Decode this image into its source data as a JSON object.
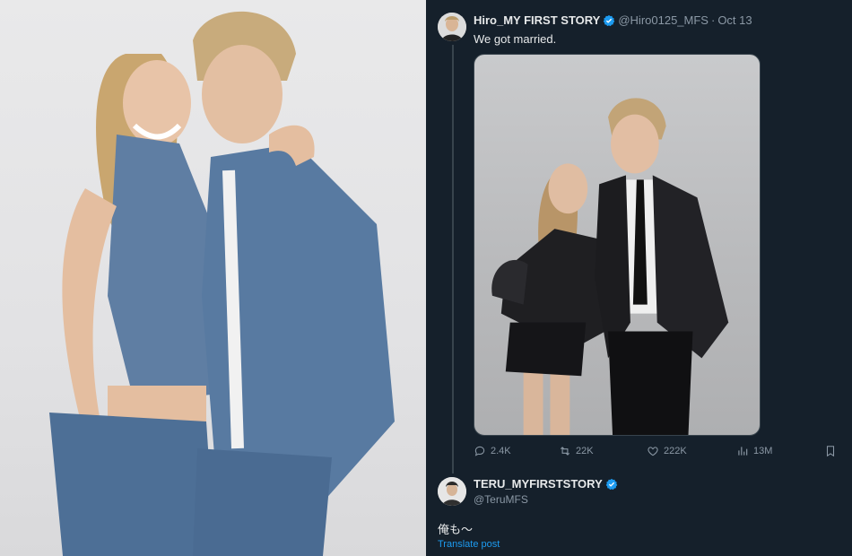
{
  "left_photo": {
    "icon": "couple-denim-photo"
  },
  "post": {
    "display_name": "Hiro_MY FIRST STORY",
    "handle": "@Hiro0125_MFS",
    "separator": "·",
    "date": "Oct 13",
    "text": "We got married.",
    "media_icon": "couple-leather-photo",
    "actions": {
      "replies": "2.4K",
      "reposts": "22K",
      "likes": "222K",
      "views": "13M"
    }
  },
  "reply": {
    "display_name": "TERU_MYFIRSTSTORY",
    "handle": "@TeruMFS",
    "text": "俺も〜",
    "translate_label": "Translate post"
  },
  "colors": {
    "background": "#15202b",
    "text_primary": "#e7e9ea",
    "text_secondary": "#8b98a5",
    "accent": "#1d9bf0",
    "border": "#38444d"
  }
}
